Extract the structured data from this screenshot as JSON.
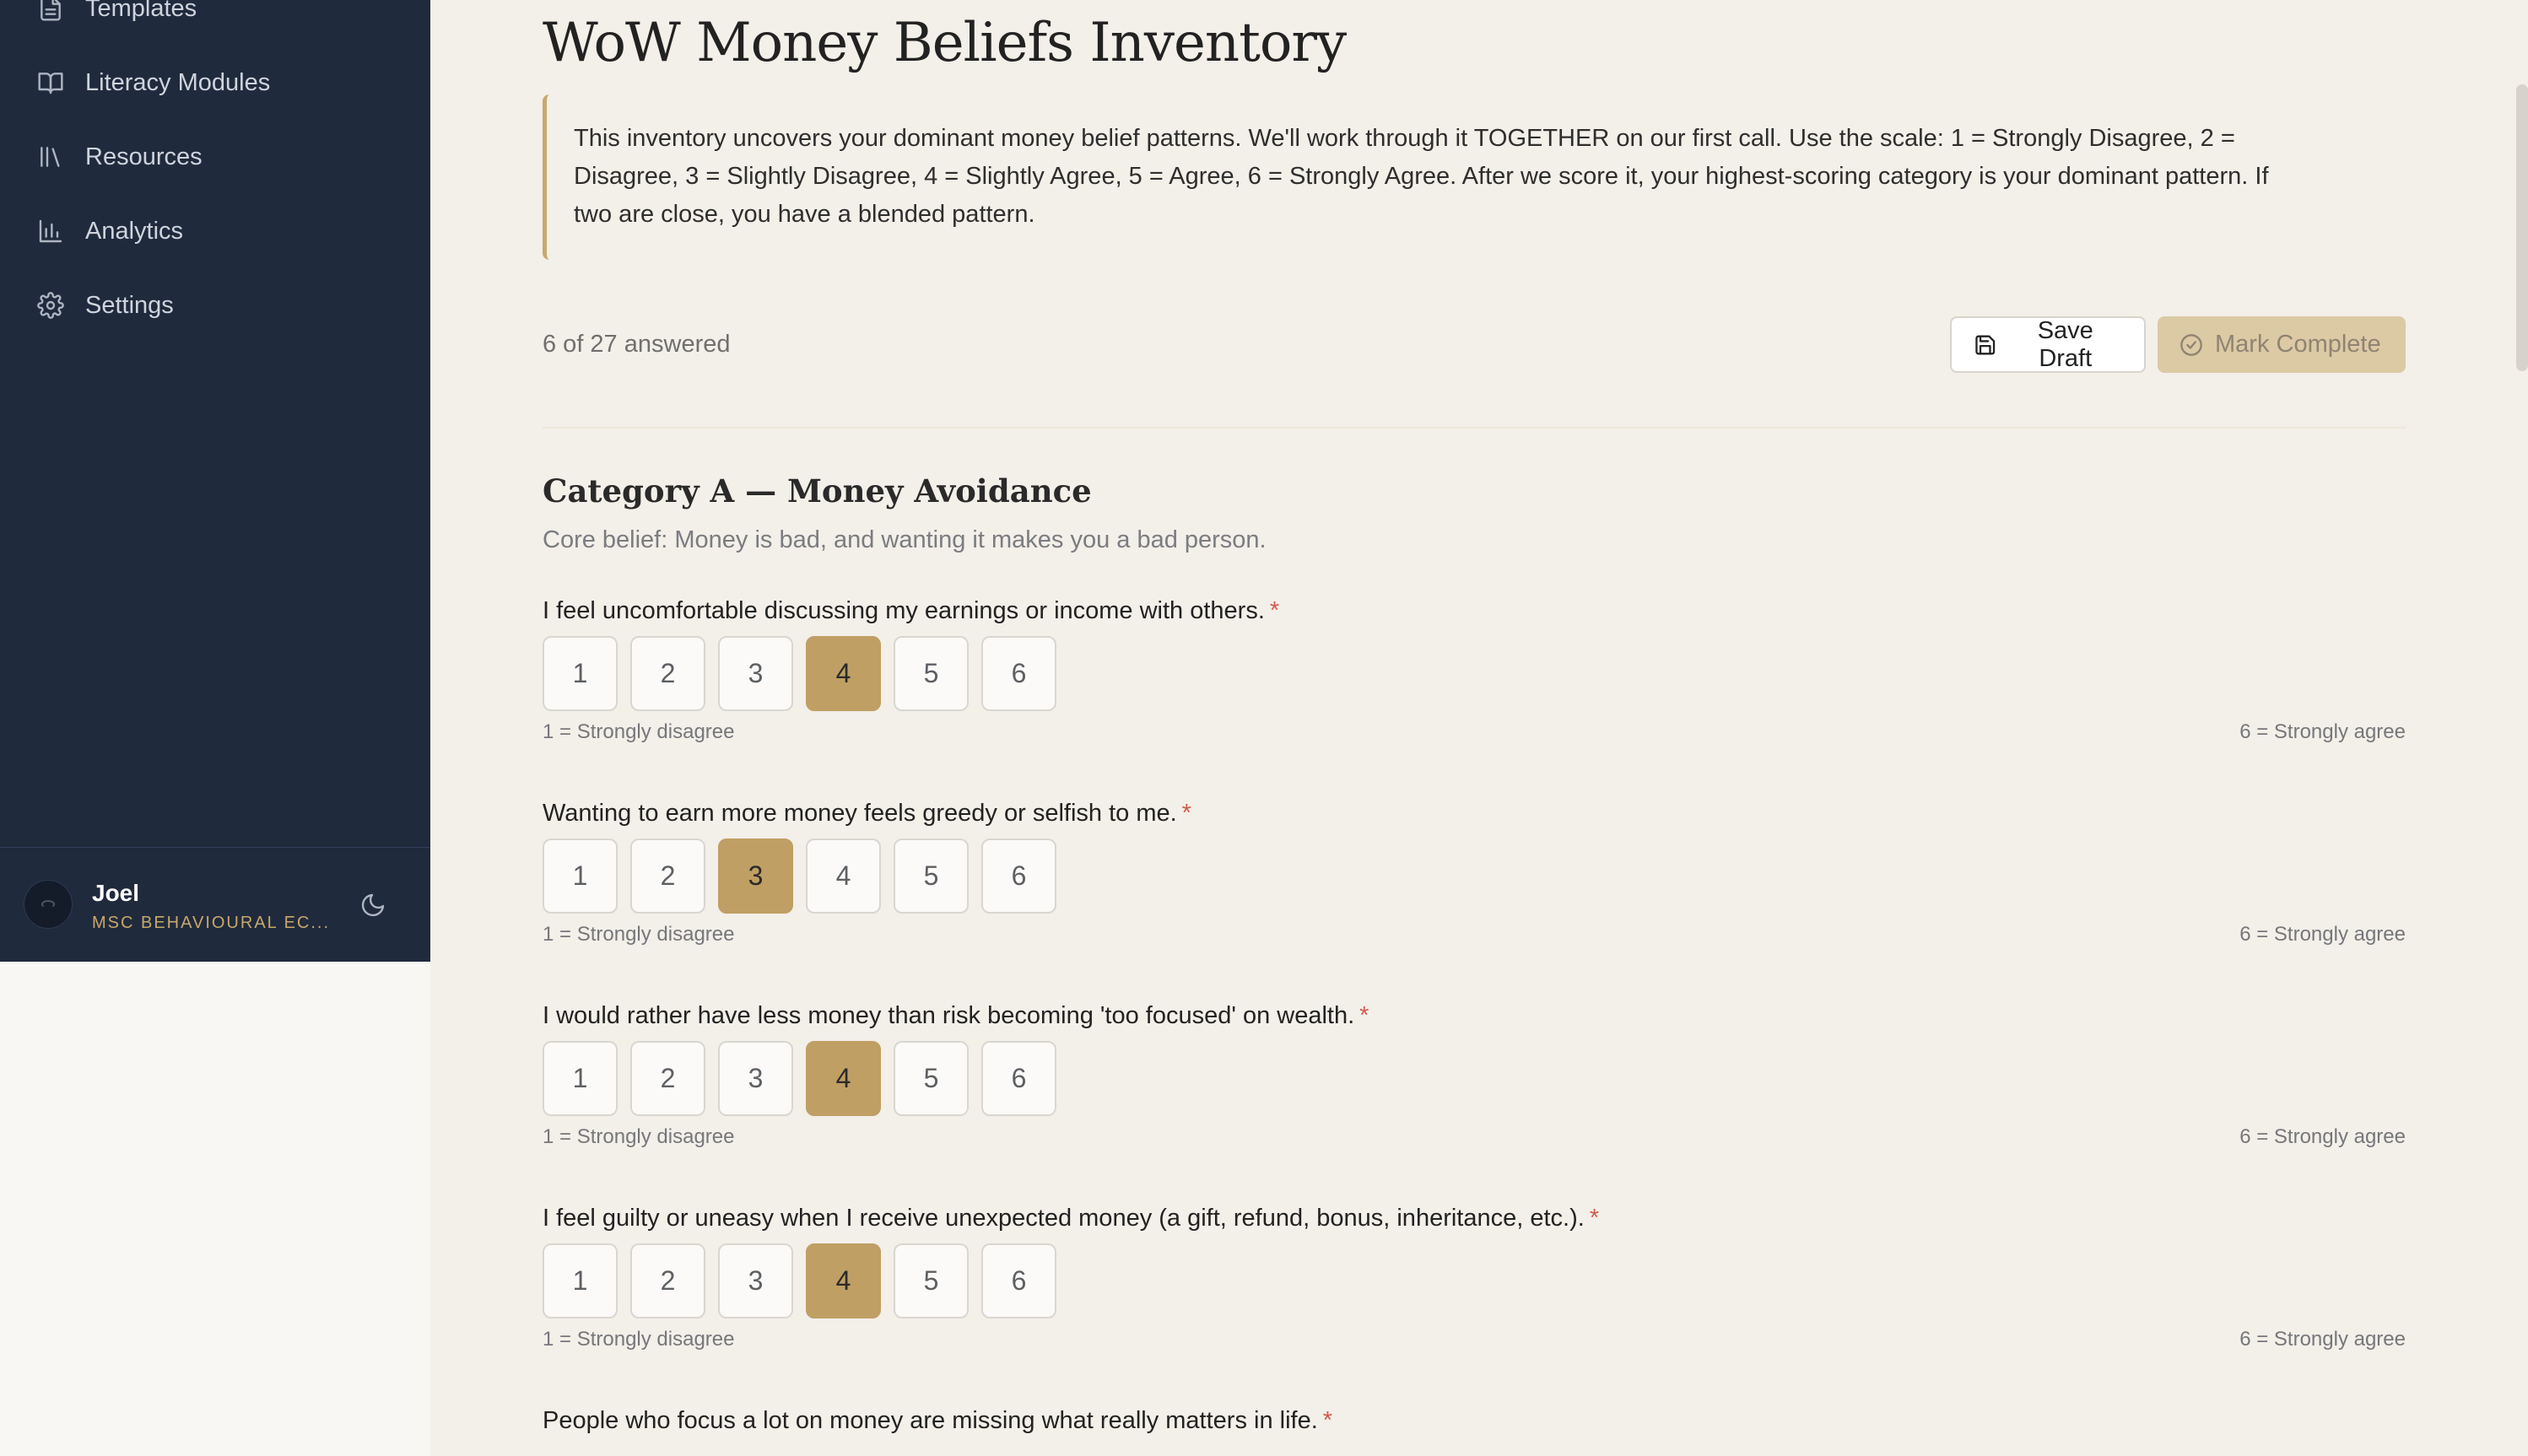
{
  "sidebar": {
    "items": [
      {
        "label": "Templates",
        "icon": "file-text-icon"
      },
      {
        "label": "Literacy Modules",
        "icon": "book-open-icon"
      },
      {
        "label": "Resources",
        "icon": "library-icon"
      },
      {
        "label": "Analytics",
        "icon": "bar-chart-icon"
      },
      {
        "label": "Settings",
        "icon": "gear-icon"
      }
    ],
    "user": {
      "name": "Joel",
      "role": "MSC BEHAVIOURAL EC..."
    }
  },
  "main": {
    "title": "WoW Money Beliefs Inventory",
    "intro": "This inventory uncovers your dominant money belief patterns. We'll work through it TOGETHER on our first call. Use the scale: 1 = Strongly Disagree, 2 = Disagree, 3 = Slightly Disagree, 4 = Slightly Agree, 5 = Agree, 6 = Strongly Agree. After we score it, your highest-scoring category is your dominant pattern. If two are close, you have a blended pattern.",
    "progress": "6 of 27 answered",
    "save_label": "Save Draft",
    "complete_label": "Mark Complete",
    "category": {
      "title": "Category A — Money Avoidance",
      "description": "Core belief: Money is bad, and wanting it makes you a bad person."
    },
    "scale_options": [
      "1",
      "2",
      "3",
      "4",
      "5",
      "6"
    ],
    "scale_low": "1 = Strongly disagree",
    "scale_high": "6 = Strongly agree",
    "questions": [
      {
        "text": "I feel uncomfortable discussing my earnings or income with others.",
        "selected": 4
      },
      {
        "text": "Wanting to earn more money feels greedy or selfish to me.",
        "selected": 3
      },
      {
        "text": "I would rather have less money than risk becoming 'too focused' on wealth.",
        "selected": 4
      },
      {
        "text": "I feel guilty or uneasy when I receive unexpected money (a gift, refund, bonus, inheritance, etc.).",
        "selected": 4
      },
      {
        "text": "People who focus a lot on money are missing what really matters in life.",
        "selected": null
      }
    ]
  },
  "colors": {
    "sidebar_bg": "#1f2a3d",
    "main_bg": "#f3efe9",
    "accent": "#bf9f64",
    "required": "#d35a4a"
  }
}
